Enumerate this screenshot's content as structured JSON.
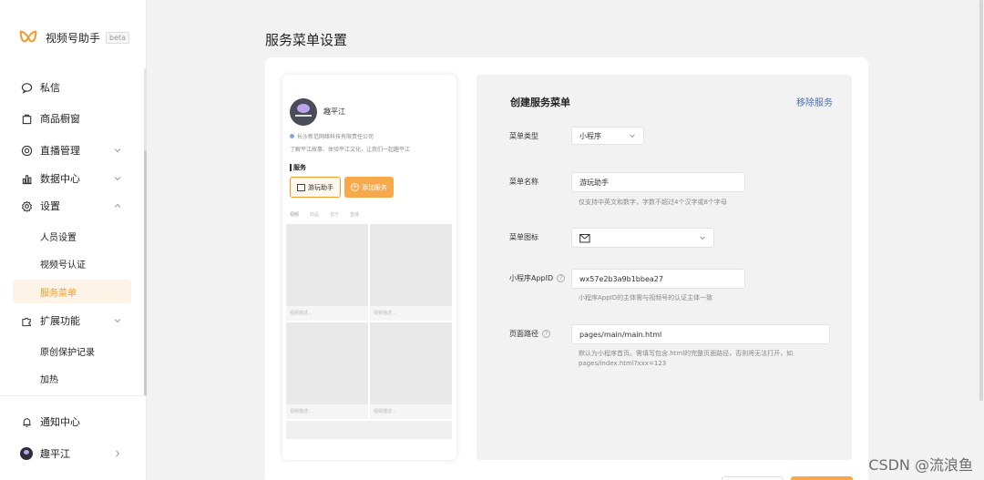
{
  "brand": {
    "name": "视频号助手",
    "beta": "beta",
    "accent": "#f29a2e"
  },
  "sidebar": {
    "items": [
      {
        "label": "私信",
        "icon": "chat-bubble-icon"
      },
      {
        "label": "商品橱窗",
        "icon": "shopping-bag-icon"
      },
      {
        "label": "直播管理",
        "icon": "live-icon"
      },
      {
        "label": "数据中心",
        "icon": "bar-chart-icon"
      },
      {
        "label": "设置",
        "icon": "gear-icon"
      }
    ],
    "settings_sub": [
      "人员设置",
      "视频号认证",
      "服务菜单"
    ],
    "extend": {
      "label": "扩展功能",
      "icon": "puzzle-icon"
    },
    "extend_sub": [
      "原创保护记录",
      "加热"
    ],
    "notify": {
      "label": "通知中心",
      "icon": "bell-icon"
    },
    "account": {
      "label": "趣平江"
    }
  },
  "page": {
    "title": "服务菜单设置"
  },
  "preview": {
    "name": "趣平江",
    "company": "长沙新范网络科技有限责任公司",
    "desc": "了解平江故事、体验平江文化，让我们一起趣平江",
    "service_heading": "服务",
    "service_btn": "游玩助手",
    "add_btn": "添加服务",
    "tabs": [
      "视频",
      "商品",
      "音乐",
      "直播"
    ],
    "cell_label": "视频描述..."
  },
  "form": {
    "title": "创建服务菜单",
    "remove": "移除服务",
    "menu_type": {
      "label": "菜单类型",
      "value": "小程序"
    },
    "menu_name": {
      "label": "菜单名称",
      "value": "游玩助手",
      "hint": "仅支持中英文和数字，字数不超过4个汉字或8个字母"
    },
    "menu_icon": {
      "label": "菜单图标"
    },
    "appid": {
      "label": "小程序AppID",
      "value": "wx57e2b3a9b1bbea27",
      "hint": "小程序AppID的主体需与视频号的认证主体一致"
    },
    "path": {
      "label": "页面路径",
      "value": "pages/main/main.html",
      "hint1": "默认为小程序首页。需填写包含.html的完整页面路径，否则将无法打开，如",
      "hint2": "pages/index.html?xxx=123"
    }
  },
  "watermark": "CSDN @流浪鱼"
}
